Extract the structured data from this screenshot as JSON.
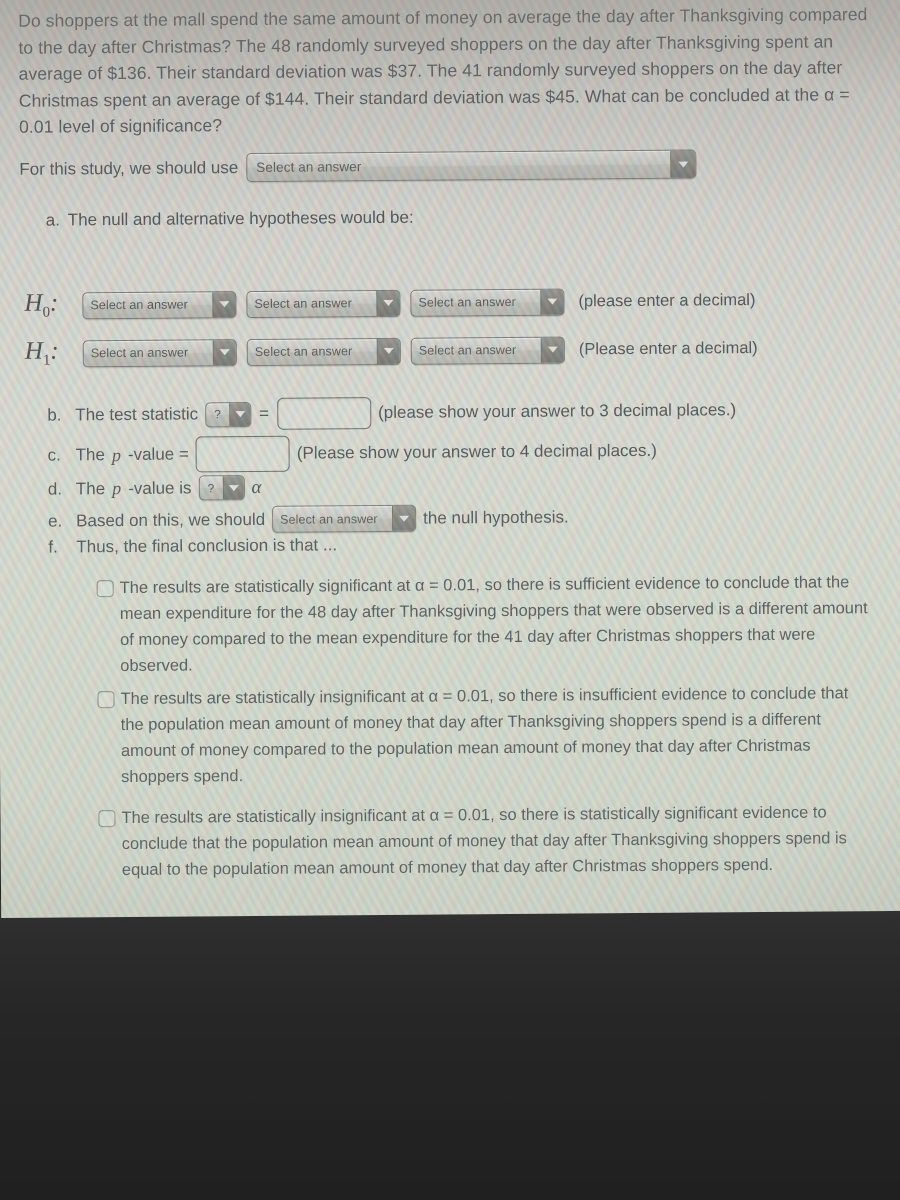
{
  "problem": {
    "prompt": "Do shoppers at the mall spend the same amount of money on average the day after Thanksgiving compared to the day after Christmas? The 48 randomly surveyed shoppers on the day after Thanksgiving spent an average of $136. Their standard deviation was $37. The 41 randomly surveyed shoppers on the day after Christmas spent an average of $144. Their standard deviation was $45. What can be concluded at the α = 0.01 level of significance?"
  },
  "study": {
    "label": "For this study, we should use",
    "select_value": "Select an answer"
  },
  "item_a": {
    "marker": "a.",
    "text": "The null and alternative hypotheses would be:"
  },
  "hypotheses": [
    {
      "label": "H",
      "sub": "0",
      "colon": ":",
      "selects": [
        "Select an answer",
        "Select an answer",
        "Select an answer"
      ],
      "note": "(please enter a decimal)"
    },
    {
      "label": "H",
      "sub": "1",
      "colon": ":",
      "selects": [
        "Select an answer",
        "Select an answer",
        "Select an answer"
      ],
      "note": "(Please enter a decimal)"
    }
  ],
  "item_b": {
    "marker": "b.",
    "text": "The test statistic",
    "select_value": "?",
    "equals": "=",
    "input_value": "",
    "note": "(please show your answer to 3 decimal places.)"
  },
  "item_c": {
    "marker": "c.",
    "text_pre": "The",
    "pvar": "p",
    "text_post": "-value =",
    "input_value": "",
    "note": "(Please show your answer to 4 decimal places.)"
  },
  "item_d": {
    "marker": "d.",
    "text_pre": "The",
    "pvar": "p",
    "text_post": "-value is",
    "select_value": "?",
    "alpha": "α"
  },
  "item_e": {
    "marker": "e.",
    "text_pre": "Based on this, we should",
    "select_value": "Select an answer",
    "text_post": "the null hypothesis."
  },
  "item_f": {
    "marker": "f.",
    "text": "Thus, the final conclusion is that ..."
  },
  "choices": [
    {
      "checked": false,
      "text": "The results are statistically significant at α = 0.01, so there is sufficient evidence to conclude that the mean expenditure for the 48 day after Thanksgiving shoppers that were observed is a different amount of money compared to the mean expenditure for the 41 day after Christmas shoppers that were observed."
    },
    {
      "checked": false,
      "text": "The results are statistically insignificant at α = 0.01, so there is insufficient evidence to conclude that the population mean amount of money that day after Thanksgiving shoppers spend is a different amount of money compared to the population mean amount of money that day after Christmas shoppers spend."
    },
    {
      "checked": false,
      "text": "The results are statistically insignificant at α = 0.01, so there is statistically significant evidence to conclude that the population mean amount of money that day after Thanksgiving shoppers spend is equal to the population mean amount of money that day after Christmas shoppers spend."
    }
  ],
  "icons": {
    "dropdown_arrow": "chevron-down-icon",
    "checkbox": "checkbox-icon"
  },
  "colors": {
    "text": "#40444a",
    "screen_background": "#d6d5d0",
    "select_body": "#c9c9c5",
    "select_arrow_button": "#7b7b77",
    "bezel": "#262626"
  }
}
